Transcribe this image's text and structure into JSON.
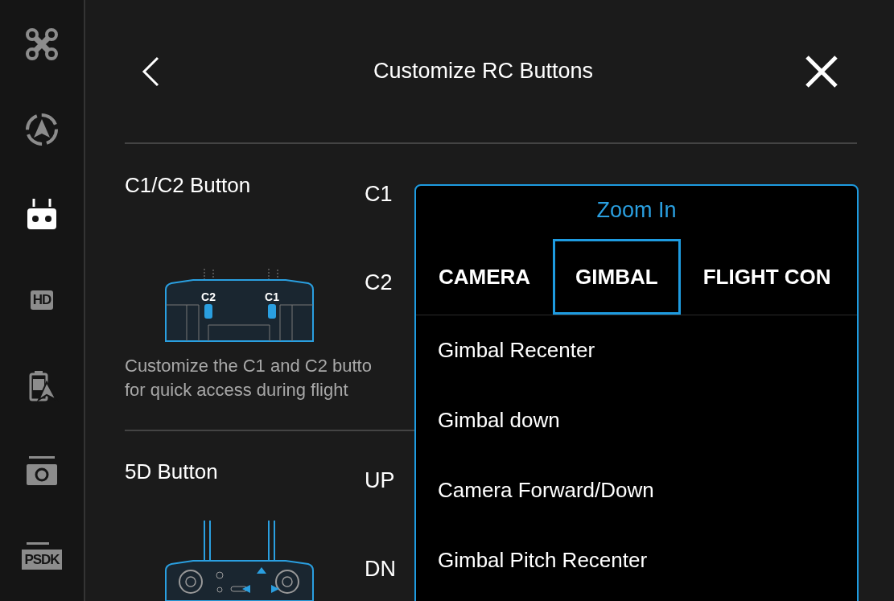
{
  "sidebar": {
    "items": [
      {
        "kind": "drone",
        "selected": false
      },
      {
        "kind": "navigation",
        "selected": false
      },
      {
        "kind": "controller",
        "selected": true
      },
      {
        "kind": "hd",
        "label": "HD",
        "selected": false
      },
      {
        "kind": "battery",
        "selected": false
      },
      {
        "kind": "camera",
        "selected": false
      },
      {
        "kind": "psdk",
        "label": "PSDK",
        "selected": false
      }
    ]
  },
  "header": {
    "title": "Customize RC Buttons"
  },
  "sections": [
    {
      "kind": "c1c2",
      "title": "C1/C2 Button",
      "buttons": [
        "C1",
        "C2"
      ],
      "diagram_labels": [
        "C2",
        "C1"
      ],
      "description": "Customize the C1 and C2 butto\nfor quick access during flight"
    },
    {
      "kind": "five_d",
      "title": "5D Button",
      "buttons": [
        "UP",
        "DN"
      ]
    }
  ],
  "dropdown": {
    "title": "Zoom In",
    "tabs": [
      {
        "label": "CAMERA",
        "selected": false
      },
      {
        "label": "GIMBAL",
        "selected": true
      },
      {
        "label": "FLIGHT CON",
        "selected": false
      }
    ],
    "items": [
      "Gimbal Recenter",
      "Gimbal down",
      "Camera Forward/Down",
      "Gimbal Pitch Recenter"
    ]
  }
}
